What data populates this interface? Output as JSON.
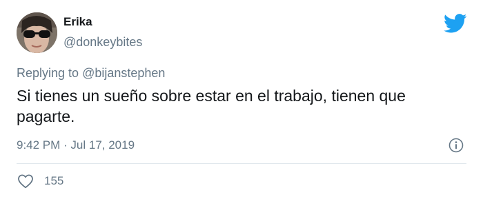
{
  "author": {
    "name": "Erika",
    "handle": "@donkeybites"
  },
  "reply": {
    "prefix": "Replying to",
    "to_user": "@bijanstephen"
  },
  "tweet": {
    "text": "Si tienes un sueño sobre estar en el trabajo, tienen que pagarte.",
    "timestamp": "9:42 PM · Jul 17, 2019"
  },
  "engagement": {
    "likes": "155"
  },
  "icons": {
    "brand": "twitter-bird-icon",
    "info": "info-icon",
    "like": "heart-icon"
  },
  "colors": {
    "brand": "#1da1f2",
    "secondary_text": "#657786",
    "primary_text": "#14171a",
    "divider": "#e1e8ed"
  }
}
